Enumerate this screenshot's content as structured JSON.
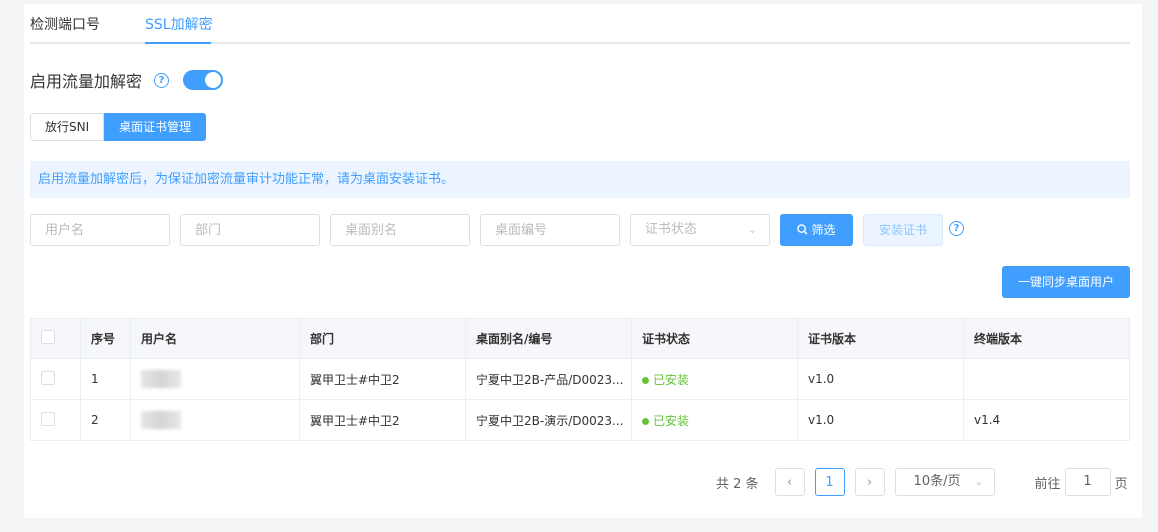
{
  "tabs": [
    {
      "label": "检测端口号"
    },
    {
      "label": "SSL加解密"
    }
  ],
  "toggle": {
    "label": "启用流量加解密",
    "on": true
  },
  "segments": [
    {
      "label": "放行SNI"
    },
    {
      "label": "桌面证书管理"
    }
  ],
  "alert": {
    "text": "启用流量加解密后，为保证加密流量审计功能正常，请为桌面安装证书。"
  },
  "filters": {
    "username_placeholder": "用户名",
    "dept_placeholder": "部门",
    "alias_placeholder": "桌面别名",
    "number_placeholder": "桌面编号",
    "status_placeholder": "证书状态"
  },
  "buttons": {
    "search": "筛选",
    "install": "安装证书",
    "sync": "一键同步桌面用户"
  },
  "table": {
    "headers": [
      "序号",
      "用户名",
      "部门",
      "桌面别名/编号",
      "证书状态",
      "证书版本",
      "终端版本"
    ],
    "rows": [
      {
        "index": "1",
        "dept": "翼甲卫士#中卫2",
        "alias": "宁夏中卫2B-产品/D0023...",
        "status": "已安装",
        "cert_version": "v1.0",
        "client_version": ""
      },
      {
        "index": "2",
        "dept": "翼甲卫士#中卫2",
        "alias": "宁夏中卫2B-演示/D0023...",
        "status": "已安装",
        "cert_version": "v1.0",
        "client_version": "v1.4"
      }
    ]
  },
  "pagination": {
    "total_text": "共 2 条",
    "current_page": "1",
    "page_size": "10条/页",
    "goto_label": "前往",
    "goto_value": "1",
    "page_suffix": "页"
  },
  "colors": {
    "accent": "#409eff",
    "success": "#67c23a"
  }
}
